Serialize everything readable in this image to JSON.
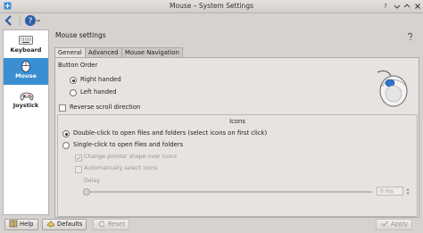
{
  "window": {
    "title": "Mouse – System Settings",
    "buttons": [
      "help-icon",
      "minimize-icon",
      "maximize-icon",
      "close-icon"
    ]
  },
  "toolbar": {
    "back_icon": "back-arrow-icon",
    "help_menu_icon": "help-menu-icon"
  },
  "sidebar": {
    "items": [
      {
        "label": "Keyboard",
        "icon": "keyboard-icon",
        "active": false
      },
      {
        "label": "Mouse",
        "icon": "mouse-icon",
        "active": true
      },
      {
        "label": "Joystick",
        "icon": "joystick-icon",
        "active": false
      }
    ]
  },
  "main": {
    "heading": "Mouse settings",
    "tabs": [
      {
        "label": "General",
        "active": true
      },
      {
        "label": "Advanced",
        "active": false
      },
      {
        "label": "Mouse Navigation",
        "active": false
      }
    ],
    "button_order": {
      "label": "Button Order",
      "options": [
        {
          "label": "Right handed",
          "selected": true
        },
        {
          "label": "Left handed",
          "selected": false
        }
      ]
    },
    "reverse_scroll": {
      "label": "Reverse scroll direction",
      "checked": false
    },
    "icons_group": {
      "title": "Icons",
      "options": [
        {
          "label": "Double-click to open files and folders (select icons on first click)",
          "selected": true
        },
        {
          "label": "Single-click to open files and folders",
          "selected": false
        }
      ],
      "change_pointer": {
        "label": "Change pointer shape over icons",
        "checked": true,
        "enabled": false
      },
      "auto_select": {
        "label": "Automatically select icons",
        "checked": false,
        "enabled": false
      },
      "delay": {
        "label": "Delay",
        "value": "0 ms",
        "fraction": 0
      }
    }
  },
  "bottom": {
    "help": "Help",
    "defaults": "Defaults",
    "reset": "Reset",
    "apply": "Apply"
  },
  "colors": {
    "accent": "#3a8fd3",
    "window_bg": "#d6d2d0",
    "panel_bg": "#e6e3e1"
  }
}
